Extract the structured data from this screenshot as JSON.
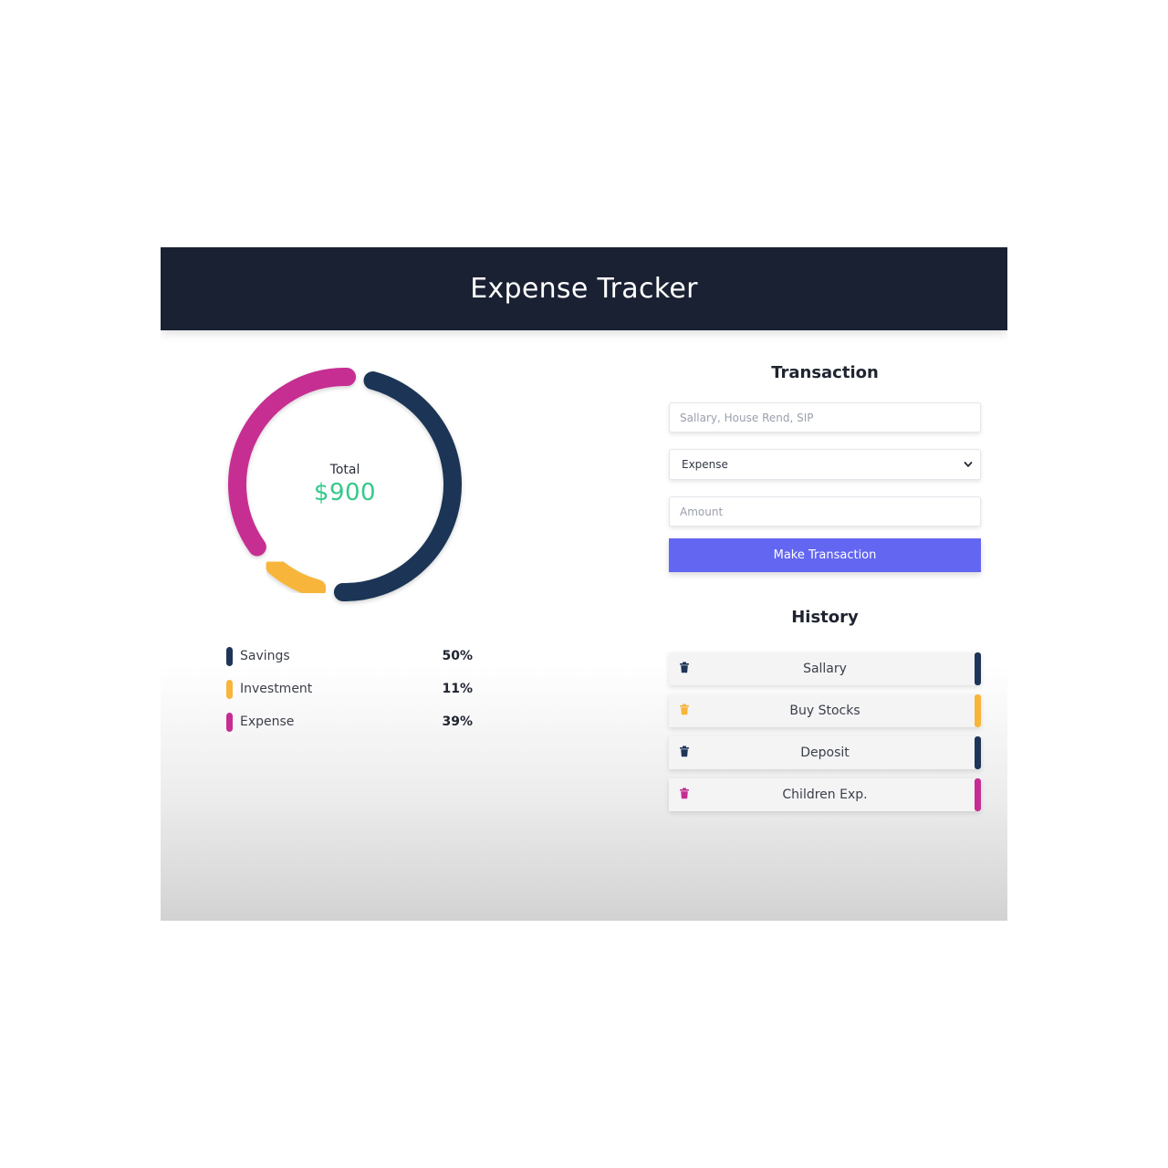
{
  "header": {
    "title": "Expense Tracker"
  },
  "summary": {
    "total_label": "Total",
    "total_value": "$900"
  },
  "chart_data": {
    "type": "pie",
    "categories": [
      "Savings",
      "Investment",
      "Expense"
    ],
    "values": [
      50,
      11,
      39
    ],
    "colors": [
      "#1e3557",
      "#f7b53a",
      "#c62d92"
    ]
  },
  "legend": [
    {
      "label": "Savings",
      "value": "50%",
      "color": "#1e3557"
    },
    {
      "label": "Investment",
      "value": "11%",
      "color": "#f7b53a"
    },
    {
      "label": "Expense",
      "value": "39%",
      "color": "#c62d92"
    }
  ],
  "transaction": {
    "title": "Transaction",
    "name_placeholder": "Sallary, House Rend, SIP",
    "type_value": "Expense",
    "amount_placeholder": "Amount",
    "button_label": "Make Transaction"
  },
  "history": {
    "title": "History",
    "items": [
      {
        "label": "Sallary",
        "color": "#1e3557"
      },
      {
        "label": "Buy Stocks",
        "color": "#f7b53a"
      },
      {
        "label": "Deposit",
        "color": "#1e3557"
      },
      {
        "label": "Children Exp.",
        "color": "#c62d92"
      }
    ]
  },
  "colors": {
    "accent": "#6366f1",
    "header_bg": "#1a2133",
    "total_green": "#34c98a"
  }
}
